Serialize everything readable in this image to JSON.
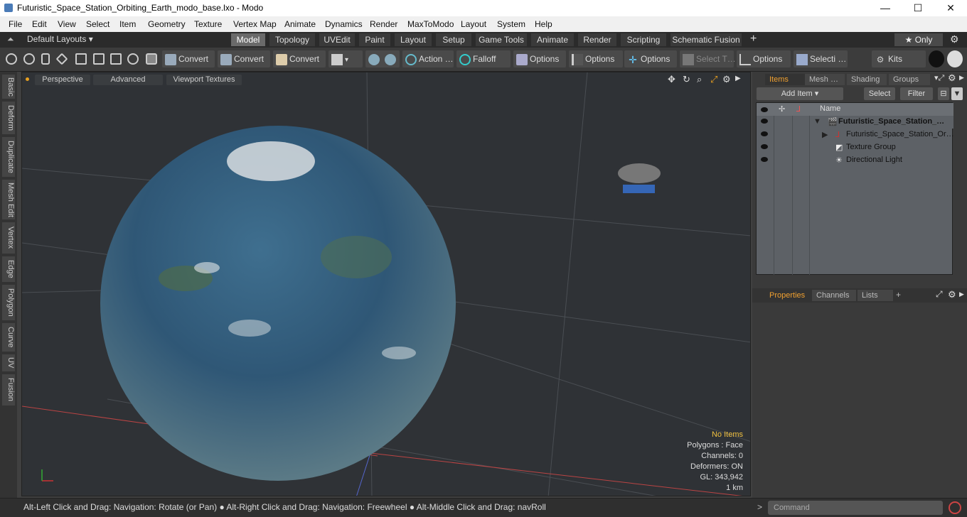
{
  "window": {
    "title": "Futuristic_Space_Station_Orbiting_Earth_modo_base.lxo - Modo",
    "min": "—",
    "max": "☐",
    "close": "✕"
  },
  "menu": [
    "File",
    "Edit",
    "View",
    "Select",
    "Item",
    "Geometry",
    "Texture",
    "Vertex Map",
    "Animate",
    "Dynamics",
    "Render",
    "MaxToModo",
    "Layout",
    "System",
    "Help"
  ],
  "layoutbar": {
    "layouts": "Default Layouts ▾",
    "tabs": [
      "Model",
      "Topology",
      "UVEdit",
      "Paint",
      "Layout",
      "Setup",
      "Game Tools",
      "Animate",
      "Render",
      "Scripting",
      "Schematic Fusion"
    ],
    "active": "Model",
    "plus": "+",
    "only": "★  Only",
    "gear": "⚙"
  },
  "toolbar": {
    "convert1": "Convert",
    "convert2": "Convert",
    "convert3": "Convert",
    "action": "Action …",
    "falloff": "Falloff",
    "options1": "Options",
    "options2": "Options",
    "options3": "Options",
    "selectt": "Select T…",
    "options4": "Options",
    "selecti": "Selecti …",
    "kits": "Kits"
  },
  "lefttabs": [
    "Basic",
    "Deform",
    "Duplicate",
    "Mesh Edit",
    "Vertex",
    "Edge",
    "Polygon",
    "Curve",
    "UV",
    "Fusion"
  ],
  "viewport": {
    "perspective": "Perspective",
    "advanced": "Advanced",
    "textures": "Viewport Textures",
    "info": {
      "items": "No Items",
      "polygons": "Polygons : Face",
      "channels": "Channels: 0",
      "deformers": "Deformers: ON",
      "gl": "GL: 343,942",
      "scale": "1 km"
    }
  },
  "rightpanel": {
    "tabs": [
      "Items",
      "Mesh …",
      "Shading",
      "Groups"
    ],
    "active": "Items",
    "add_item": "Add Item",
    "select": "Select",
    "filter": "Filter",
    "col_name": "Name",
    "items": [
      {
        "name": "Futuristic_Space_Station_…",
        "bold": true
      },
      {
        "name": "Futuristic_Space_Station_Or…",
        "bold": false
      },
      {
        "name": "Texture Group",
        "bold": false
      },
      {
        "name": "Directional Light",
        "bold": false
      }
    ],
    "prop_tabs": [
      "Properties",
      "Channels",
      "Lists"
    ],
    "prop_active": "Properties",
    "plus": "+"
  },
  "status": {
    "text": "Alt-Left Click and Drag: Navigation: Rotate (or Pan) ● Alt-Right Click and Drag: Navigation: Freewheel ● Alt-Middle Click and Drag: navRoll",
    "command": "Command",
    ">": ">"
  }
}
